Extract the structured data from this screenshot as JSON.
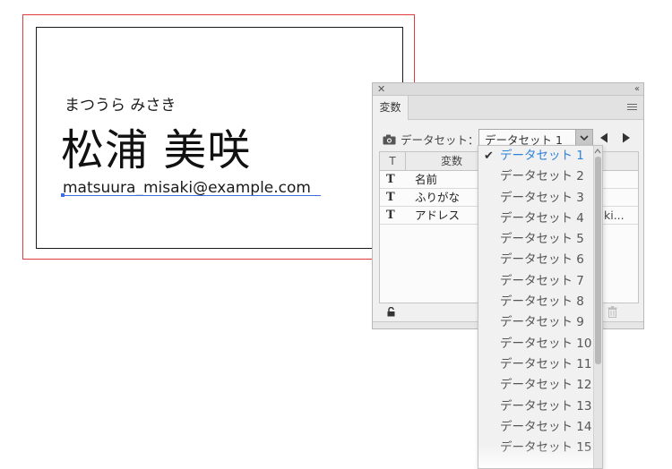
{
  "card": {
    "kana": "まつうら みさき",
    "name": "松浦 美咲",
    "email": "matsuura_misaki@example.com"
  },
  "panel": {
    "tab_label": "変数",
    "dataset_label": "データセット：",
    "selected_dataset": "データセット 1",
    "table": {
      "col_type": "T",
      "col_variable": "変数",
      "rows": [
        {
          "type": "T",
          "name": "名前",
          "value": ""
        },
        {
          "type": "T",
          "name": "ふりがな",
          "value": ""
        },
        {
          "type": "T",
          "name": "アドレス",
          "value": "ki..."
        }
      ]
    }
  },
  "dropdown": {
    "items": [
      "データセット 1",
      "データセット 2",
      "データセット 3",
      "データセット 4",
      "データセット 5",
      "データセット 6",
      "データセット 7",
      "データセット 8",
      "データセット 9",
      "データセット 10",
      "データセット 11",
      "データセット 12",
      "データセット 13",
      "データセット 14",
      "データセット 15"
    ],
    "selected_index": 0,
    "selected_color": "#2f83d9"
  },
  "icons": {
    "close": "close-icon",
    "collapse": "collapse-icon",
    "menu": "panel-menu-icon",
    "camera": "camera-icon",
    "prev": "previous-dataset-icon",
    "next": "next-dataset-icon",
    "lock": "lock-icon",
    "trash": "trash-icon",
    "check": "checkmark-icon"
  },
  "colors": {
    "artboard_border": "#e0393e",
    "selection_blue": "#3f6ee0"
  }
}
